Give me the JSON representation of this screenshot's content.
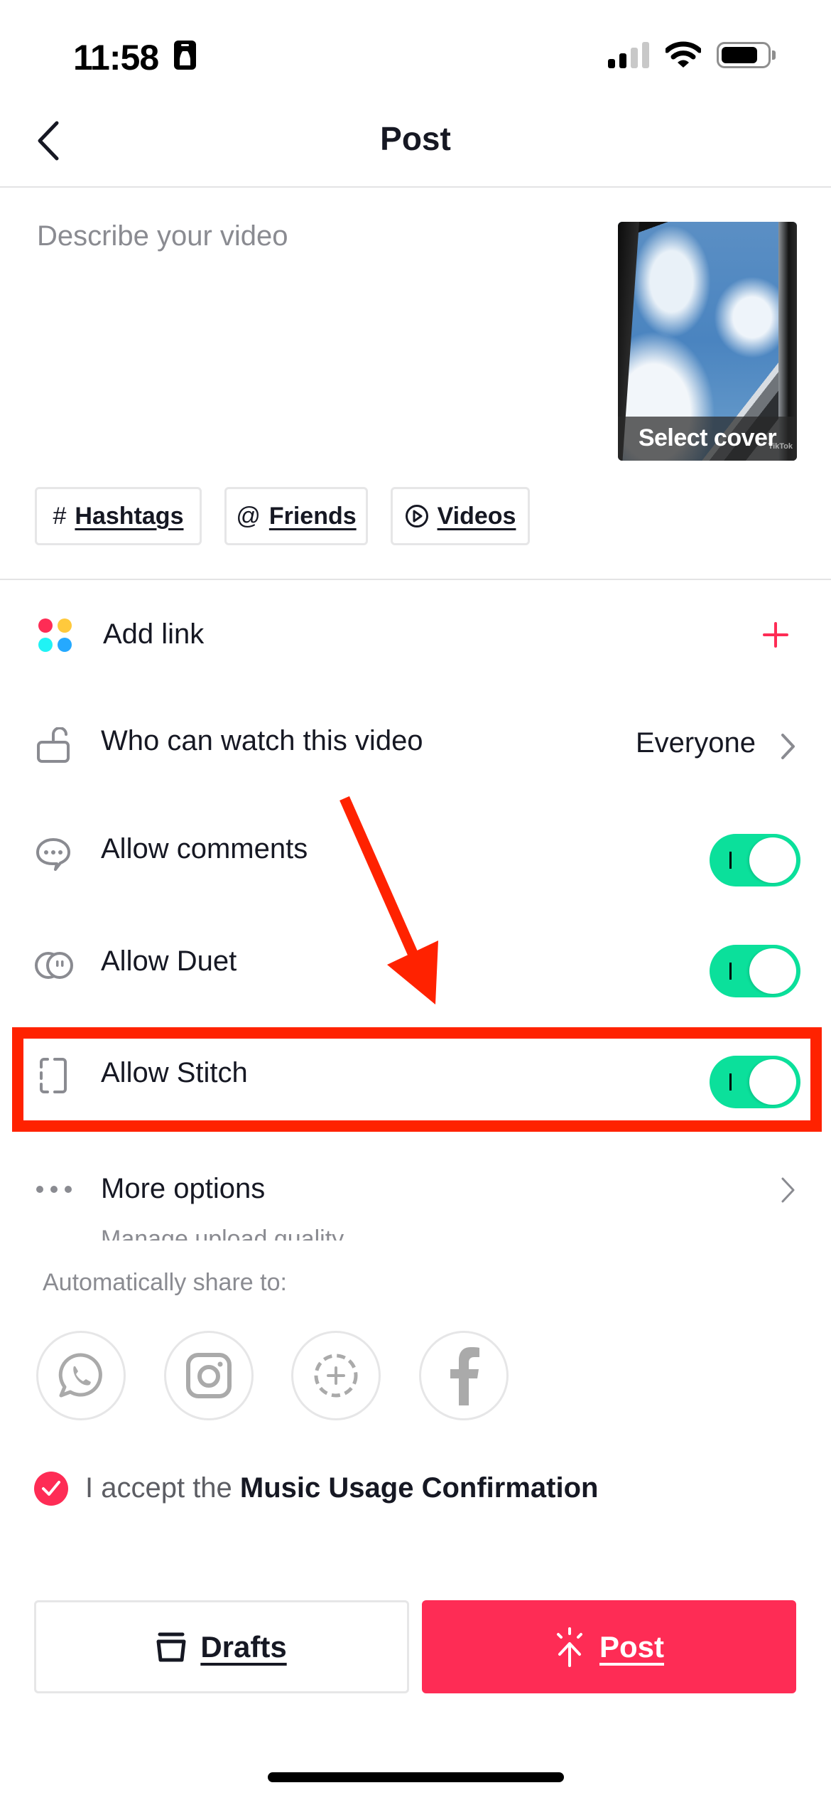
{
  "status_bar": {
    "time": "11:58",
    "badge_icon": "person-id-badge-icon",
    "signal_bars_active": 2,
    "signal_bars_total": 4,
    "wifi_icon": "wifi-icon",
    "battery_level": 0.8
  },
  "header": {
    "back_icon": "chevron-left-icon",
    "title": "Post"
  },
  "composer": {
    "description_value": "",
    "description_placeholder": "Describe your video",
    "cover_label": "Select cover",
    "cover_watermark": "TikTok"
  },
  "chips": [
    {
      "icon": "hashtag-icon",
      "glyph": "#",
      "label": "Hashtags"
    },
    {
      "icon": "at-icon",
      "glyph": "@",
      "label": "Friends"
    },
    {
      "icon": "play-circle-icon",
      "glyph": "",
      "label": "Videos"
    }
  ],
  "settings": {
    "add_link": {
      "label": "Add link",
      "icon": "add-link-apps-icon",
      "action_icon": "plus-icon",
      "colors": [
        "#FE2C55",
        "#FFC93C",
        "#20F3F5",
        "#25A9FF"
      ]
    },
    "who_can_watch": {
      "label": "Who can watch this video",
      "icon": "unlock-icon",
      "value": "Everyone"
    },
    "allow_comments": {
      "label": "Allow comments",
      "icon": "comment-bubble-icon",
      "on": true
    },
    "allow_duet": {
      "label": "Allow Duet",
      "icon": "duet-icon",
      "on": true
    },
    "allow_stitch": {
      "label": "Allow Stitch",
      "icon": "stitch-icon",
      "on": true
    },
    "more_options": {
      "label": "More options",
      "icon": "more-dots-icon",
      "sublabel": "Manage upload quality"
    }
  },
  "share": {
    "label": "Automatically share to:",
    "targets": [
      {
        "name": "whatsapp",
        "icon": "whatsapp-icon"
      },
      {
        "name": "instagram",
        "icon": "instagram-icon"
      },
      {
        "name": "stories",
        "icon": "add-story-icon"
      },
      {
        "name": "facebook",
        "icon": "facebook-icon"
      }
    ]
  },
  "accept": {
    "checked": true,
    "prefix": "I accept the ",
    "link": "Music Usage Confirmation"
  },
  "actions": {
    "drafts_label": "Drafts",
    "post_label": "Post"
  },
  "annotation": {
    "highlight_color": "#FF2200",
    "target": "Allow Stitch"
  },
  "colors": {
    "accent": "#FE2C55",
    "toggle_on": "#0BE09B",
    "text_primary": "#161823",
    "text_secondary": "#8A8B91"
  }
}
